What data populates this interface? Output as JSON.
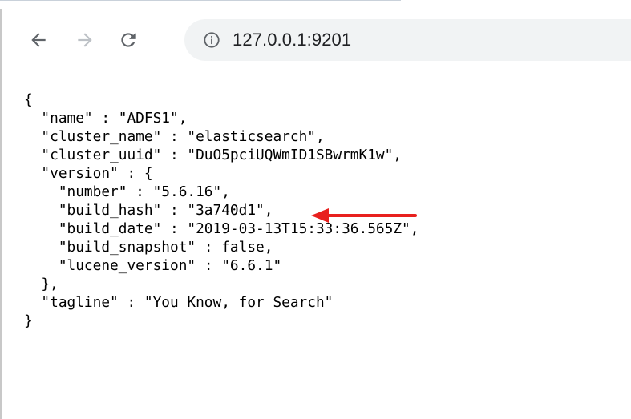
{
  "browser": {
    "back_icon": "arrow-left-icon",
    "forward_icon": "arrow-right-icon",
    "reload_icon": "reload-icon",
    "info_icon": "info-circle-icon",
    "url": "127.0.0.1:9201"
  },
  "response": {
    "lines": [
      "{",
      "  \"name\" : \"ADFS1\",",
      "  \"cluster_name\" : \"elasticsearch\",",
      "  \"cluster_uuid\" : \"DuO5pciUQWmID1SBwrmK1w\",",
      "  \"version\" : {",
      "    \"number\" : \"5.6.16\",",
      "    \"build_hash\" : \"3a740d1\",",
      "    \"build_date\" : \"2019-03-13T15:33:36.565Z\",",
      "    \"build_snapshot\" : false,",
      "    \"lucene_version\" : \"6.6.1\"",
      "  },",
      "  \"tagline\" : \"You Know, for Search\"",
      "}"
    ]
  },
  "annotation": {
    "arrow_color": "#e8201e",
    "arrow_icon": "red-arrow-left-icon"
  }
}
